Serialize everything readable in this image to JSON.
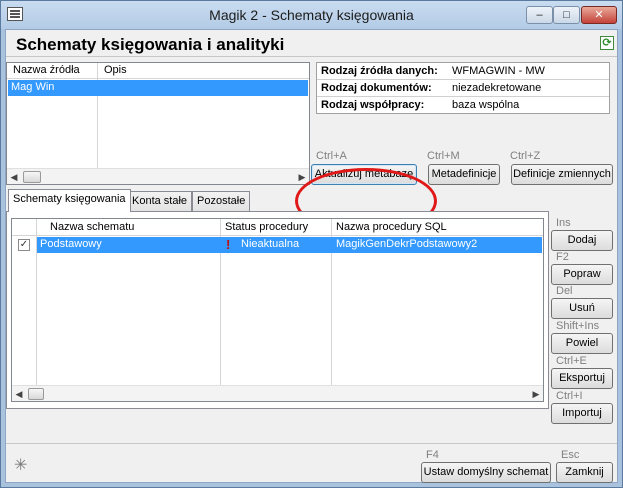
{
  "window": {
    "title": "Magik 2 - Schematy księgowania",
    "minimize": "–",
    "maximize": "□",
    "close": "✕"
  },
  "page": {
    "heading": "Schematy księgowania i analityki"
  },
  "sources": {
    "columns": [
      "Nazwa źródła",
      "Opis"
    ],
    "rows": [
      {
        "name": "Mag Win",
        "description": ""
      }
    ]
  },
  "info": {
    "rows": [
      {
        "label": "Rodzaj źródła danych:",
        "value": "WFMAGWIN - MW"
      },
      {
        "label": "Rodzaj dokumentów:",
        "value": "niezadekretowane"
      },
      {
        "label": "Rodzaj współpracy:",
        "value": "baza wspólna"
      }
    ]
  },
  "actions": {
    "update": {
      "shortcut": "Ctrl+A",
      "label": "Aktualizuj  metabazę"
    },
    "metadef": {
      "shortcut": "Ctrl+M",
      "label": "Metadefinicje"
    },
    "vars": {
      "shortcut": "Ctrl+Z",
      "label": "Definicje zmiennych"
    }
  },
  "tabs": [
    "Schematy księgowania",
    "Konta stałe",
    "Pozostałe"
  ],
  "schemes": {
    "columns": [
      "Nazwa schematu",
      "Status procedury",
      "Nazwa procedury SQL"
    ],
    "rows": [
      {
        "checked": "✓",
        "name": "Podstawowy",
        "warning": "!",
        "status": "Nieaktualna",
        "procedure": "MagikGenDekrPodstawowy2"
      }
    ]
  },
  "side_buttons": [
    {
      "shortcut": "Ins",
      "label": "Dodaj"
    },
    {
      "shortcut": "F2",
      "label": "Popraw"
    },
    {
      "shortcut": "Del",
      "label": "Usuń"
    },
    {
      "shortcut": "Shift+Ins",
      "label": "Powiel"
    },
    {
      "shortcut": "Ctrl+E",
      "label": "Eksportuj"
    },
    {
      "shortcut": "Ctrl+I",
      "label": "Importuj"
    }
  ],
  "footer": {
    "default_shortcut": "F4",
    "default_label": "Ustaw domyślny schemat",
    "close_shortcut": "Esc",
    "close_label": "Zamknij"
  },
  "colors": {
    "selection": "#3399ff",
    "highlight_ellipse": "#e01818"
  }
}
